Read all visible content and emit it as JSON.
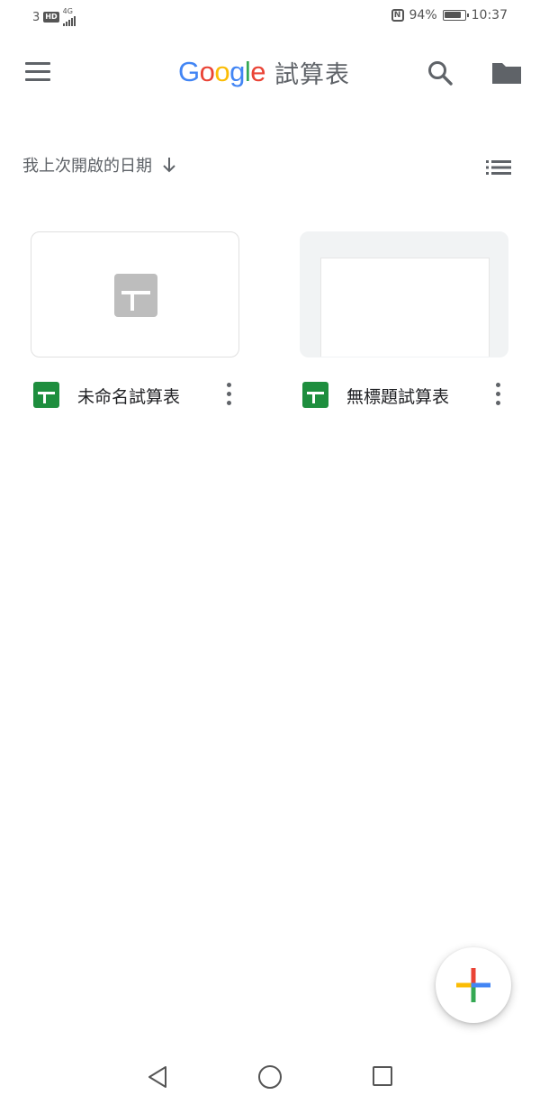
{
  "status_bar": {
    "sim_slot": "3",
    "hd_badge": "HD",
    "network": "4G",
    "battery_percent": "94%",
    "battery_level": 0.94,
    "time": "10:37",
    "icons": [
      "hd-icon",
      "signal-icon",
      "nfc-icon",
      "battery-icon"
    ]
  },
  "app_bar": {
    "logo_letters": [
      {
        "char": "G",
        "color": "#4285F4"
      },
      {
        "char": "o",
        "color": "#EA4335"
      },
      {
        "char": "o",
        "color": "#FBBC05"
      },
      {
        "char": "g",
        "color": "#4285F4"
      },
      {
        "char": "l",
        "color": "#34A853"
      },
      {
        "char": "e",
        "color": "#EA4335"
      }
    ],
    "app_name": "試算表",
    "icons": [
      "menu-icon",
      "search-icon",
      "folder-icon"
    ]
  },
  "sort": {
    "label": "我上次開啟的日期",
    "direction_icon": "arrow-down-icon",
    "view_icon": "list-view-icon"
  },
  "files": [
    {
      "name": "未命名試算表",
      "thumbnail": "blank",
      "icon": "sheets-icon"
    },
    {
      "name": "無標題試算表",
      "thumbnail": "preview",
      "icon": "sheets-icon"
    }
  ],
  "fab": {
    "icon": "plus-icon",
    "colors": {
      "top": "#EA4335",
      "right": "#4285F4",
      "bottom": "#34A853",
      "left": "#FBBC05"
    }
  },
  "nav_bar": {
    "icons": [
      "back-icon",
      "home-icon",
      "recents-icon"
    ]
  },
  "colors": {
    "icon_grey": "#5f6368",
    "sheets_green": "#1e8e3e"
  }
}
